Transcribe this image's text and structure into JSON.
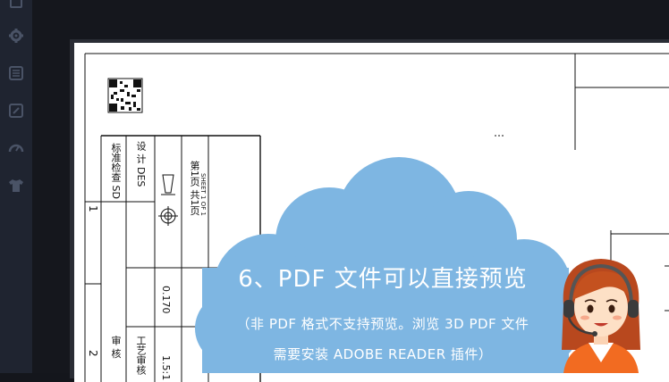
{
  "sidebar": {
    "items": [
      {
        "icon": "document-icon"
      },
      {
        "icon": "gear-icon"
      },
      {
        "icon": "list-icon"
      },
      {
        "icon": "edit-icon"
      },
      {
        "icon": "gauge-icon"
      },
      {
        "icon": "shirt-icon"
      }
    ]
  },
  "drawing": {
    "title_block": {
      "standard_check": "标准检查 SD",
      "design": "设 计 DES",
      "sheet": "第1页 共1页",
      "sheet_en": "SHEET 1 OF 1",
      "weight_value": "0.170",
      "process_review": "工艺审核",
      "review": "审 核",
      "scale_value": "1.5:1",
      "row_one": "1",
      "row_two": "2"
    }
  },
  "promo": {
    "title": "6、PDF 文件可以直接预览",
    "line1": "（非 PDF 格式不支持预览。浏览 3D PDF 文件",
    "line2": "需要安装 ADOBE READER 插件）",
    "cloud_color": "#7eb6e2"
  }
}
